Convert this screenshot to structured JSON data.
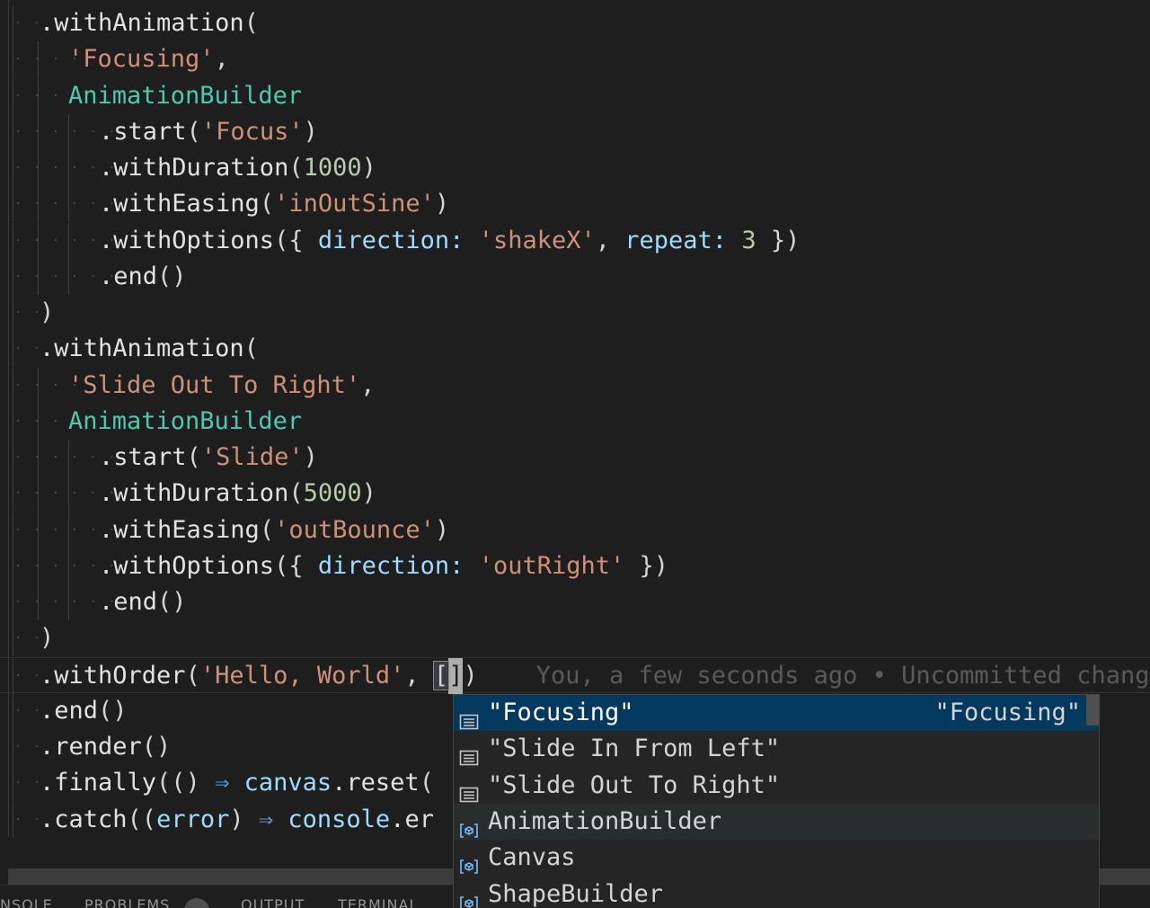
{
  "editor": {
    "lines": [
      {
        "indent": 1,
        "tokens": [
          {
            "t": ".withAnimation",
            "c": "method"
          },
          {
            "t": "(",
            "c": "punc"
          }
        ]
      },
      {
        "indent": 2,
        "tokens": [
          {
            "t": "'Focusing'",
            "c": "string"
          },
          {
            "t": ",",
            "c": "punc"
          }
        ]
      },
      {
        "indent": 2,
        "tokens": [
          {
            "t": "AnimationBuilder",
            "c": "class"
          }
        ]
      },
      {
        "indent": 3,
        "tokens": [
          {
            "t": ".start",
            "c": "method"
          },
          {
            "t": "(",
            "c": "punc"
          },
          {
            "t": "'Focus'",
            "c": "string"
          },
          {
            "t": ")",
            "c": "punc"
          }
        ]
      },
      {
        "indent": 3,
        "tokens": [
          {
            "t": ".withDuration",
            "c": "method"
          },
          {
            "t": "(",
            "c": "punc"
          },
          {
            "t": "1000",
            "c": "num"
          },
          {
            "t": ")",
            "c": "punc"
          }
        ]
      },
      {
        "indent": 3,
        "tokens": [
          {
            "t": ".withEasing",
            "c": "method"
          },
          {
            "t": "(",
            "c": "punc"
          },
          {
            "t": "'inOutSine'",
            "c": "string"
          },
          {
            "t": ")",
            "c": "punc"
          }
        ]
      },
      {
        "indent": 3,
        "tokens": [
          {
            "t": ".withOptions",
            "c": "method"
          },
          {
            "t": "({ ",
            "c": "punc"
          },
          {
            "t": "direction",
            "c": "prop"
          },
          {
            "t": ": ",
            "c": "prop"
          },
          {
            "t": "'shakeX'",
            "c": "string"
          },
          {
            "t": ", ",
            "c": "punc"
          },
          {
            "t": "repeat",
            "c": "prop"
          },
          {
            "t": ": ",
            "c": "prop"
          },
          {
            "t": "3",
            "c": "num"
          },
          {
            "t": " })",
            "c": "punc"
          }
        ]
      },
      {
        "indent": 3,
        "tokens": [
          {
            "t": ".end",
            "c": "method"
          },
          {
            "t": "()",
            "c": "punc"
          }
        ]
      },
      {
        "indent": 1,
        "tokens": [
          {
            "t": ")",
            "c": "punc"
          }
        ]
      },
      {
        "indent": 1,
        "tokens": [
          {
            "t": ".withAnimation",
            "c": "method"
          },
          {
            "t": "(",
            "c": "punc"
          }
        ]
      },
      {
        "indent": 2,
        "tokens": [
          {
            "t": "'Slide Out To Right'",
            "c": "string"
          },
          {
            "t": ",",
            "c": "punc"
          }
        ]
      },
      {
        "indent": 2,
        "tokens": [
          {
            "t": "AnimationBuilder",
            "c": "class"
          }
        ]
      },
      {
        "indent": 3,
        "tokens": [
          {
            "t": ".start",
            "c": "method"
          },
          {
            "t": "(",
            "c": "punc"
          },
          {
            "t": "'Slide'",
            "c": "string"
          },
          {
            "t": ")",
            "c": "punc"
          }
        ]
      },
      {
        "indent": 3,
        "tokens": [
          {
            "t": ".withDuration",
            "c": "method"
          },
          {
            "t": "(",
            "c": "punc"
          },
          {
            "t": "5000",
            "c": "num"
          },
          {
            "t": ")",
            "c": "punc"
          }
        ]
      },
      {
        "indent": 3,
        "tokens": [
          {
            "t": ".withEasing",
            "c": "method"
          },
          {
            "t": "(",
            "c": "punc"
          },
          {
            "t": "'outBounce'",
            "c": "string"
          },
          {
            "t": ")",
            "c": "punc"
          }
        ]
      },
      {
        "indent": 3,
        "tokens": [
          {
            "t": ".withOptions",
            "c": "method"
          },
          {
            "t": "({ ",
            "c": "punc"
          },
          {
            "t": "direction",
            "c": "prop"
          },
          {
            "t": ": ",
            "c": "prop"
          },
          {
            "t": "'outRight'",
            "c": "string"
          },
          {
            "t": " })",
            "c": "punc"
          }
        ]
      },
      {
        "indent": 3,
        "tokens": [
          {
            "t": ".end",
            "c": "method"
          },
          {
            "t": "()",
            "c": "punc"
          }
        ]
      },
      {
        "indent": 1,
        "tokens": [
          {
            "t": ")",
            "c": "punc"
          }
        ]
      },
      {
        "indent": 1,
        "current": true,
        "tokens": [
          {
            "t": ".withOrder",
            "c": "method"
          },
          {
            "t": "(",
            "c": "punc"
          },
          {
            "t": "'Hello, World'",
            "c": "string"
          },
          {
            "t": ", ",
            "c": "punc"
          },
          {
            "t": "[",
            "c": "bracket"
          },
          {
            "t": "]",
            "c": "cursor"
          },
          {
            "t": ")",
            "c": "punc"
          },
          {
            "t": "    You, a few seconds ago • Uncommitted changes",
            "c": "ghost"
          }
        ]
      },
      {
        "indent": 1,
        "tokens": [
          {
            "t": ".end",
            "c": "method"
          },
          {
            "t": "()",
            "c": "punc"
          }
        ]
      },
      {
        "indent": 1,
        "tokens": [
          {
            "t": ".render",
            "c": "method"
          },
          {
            "t": "()",
            "c": "punc"
          }
        ]
      },
      {
        "indent": 1,
        "tokens": [
          {
            "t": ".finally",
            "c": "method"
          },
          {
            "t": "(() ",
            "c": "punc"
          },
          {
            "t": "⇒",
            "c": "arrow"
          },
          {
            "t": " ",
            "c": "punc"
          },
          {
            "t": "canvas",
            "c": "var"
          },
          {
            "t": ".reset",
            "c": "method"
          },
          {
            "t": "(",
            "c": "punc"
          }
        ]
      },
      {
        "indent": 1,
        "tokens": [
          {
            "t": ".catch",
            "c": "method"
          },
          {
            "t": "((",
            "c": "punc"
          },
          {
            "t": "error",
            "c": "var"
          },
          {
            "t": ") ",
            "c": "punc"
          },
          {
            "t": "⇒",
            "c": "arrow"
          },
          {
            "t": " ",
            "c": "punc"
          },
          {
            "t": "console",
            "c": "var"
          },
          {
            "t": ".er",
            "c": "method"
          }
        ]
      }
    ]
  },
  "suggest": {
    "items": [
      {
        "label": "\"Focusing\"",
        "detail": "\"Focusing\"",
        "icon": "text-icon",
        "state": "selected"
      },
      {
        "label": "\"Slide In From Left\"",
        "detail": "",
        "icon": "text-icon",
        "state": ""
      },
      {
        "label": "\"Slide Out To Right\"",
        "detail": "",
        "icon": "text-icon",
        "state": ""
      },
      {
        "label": "AnimationBuilder",
        "detail": "",
        "icon": "variable-icon",
        "state": "hover"
      },
      {
        "label": "Canvas",
        "detail": "",
        "icon": "variable-icon",
        "state": ""
      },
      {
        "label": "ShapeBuilder",
        "detail": "",
        "icon": "variable-icon",
        "state": ""
      }
    ]
  },
  "panel": {
    "tabs": [
      "NSOLE",
      "PROBLEMS",
      "OUTPUT",
      "TERMINAL"
    ]
  },
  "colors": {
    "background": "#1e1e1e",
    "string": "#ce9178",
    "class": "#4ec9b0",
    "number": "#b5cea8",
    "property": "#9cdcfe",
    "arrow": "#569cd6",
    "selection": "#04395e"
  }
}
